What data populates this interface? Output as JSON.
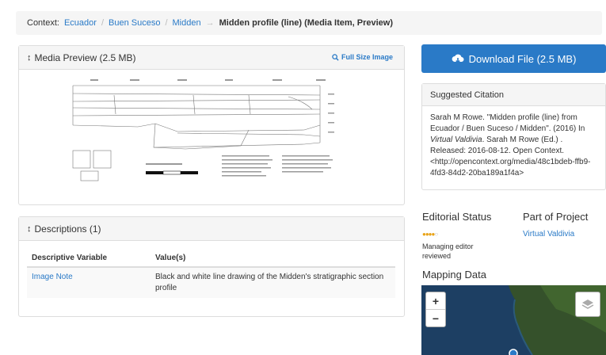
{
  "breadcrumb": {
    "context_label": "Context:",
    "items": [
      "Ecuador",
      "Buen Suceso",
      "Midden"
    ],
    "arrow": "→",
    "current": "Midden profile (line) (Media Item, Preview)"
  },
  "media_panel": {
    "title": "Media Preview (2.5 MB)",
    "full_size_label": "Full Size Image",
    "full_size_icon": "zoom-in-icon"
  },
  "descriptions_panel": {
    "title": "Descriptions (1)",
    "headers": [
      "Descriptive Variable",
      "Value(s)"
    ],
    "rows": [
      {
        "variable": "Image Note",
        "value": "Black and white line drawing of the Midden's stratigraphic section profile"
      }
    ]
  },
  "download": {
    "label": "Download File (2.5 MB)",
    "icon": "cloud-download-icon"
  },
  "citation": {
    "title": "Suggested Citation",
    "text_a": "Sarah M Rowe. \"Midden profile (line) from Ecuador / Buen Suceso / Midden\". (2016) In ",
    "text_italic": "Virtual Valdivia",
    "text_b": ". Sarah M Rowe (Ed.) . Released: 2016-08-12. Open Context. <http://opencontext.org/media/48c1bdeb-ffb9-4fd3-84d2-20ba189a1f4a>"
  },
  "editorial": {
    "title": "Editorial Status",
    "stars_on": "●●●●",
    "stars_off": "○",
    "status_text": "Managing editor reviewed"
  },
  "project": {
    "title": "Part of Project",
    "link": "Virtual Valdivia"
  },
  "mapping": {
    "title": "Mapping Data",
    "zoom_in": "+",
    "zoom_out": "−",
    "layers_icon": "layers-icon"
  },
  "colors": {
    "link": "#2a7ac7",
    "button": "#2a7ac7",
    "stars": "#e8a317"
  }
}
